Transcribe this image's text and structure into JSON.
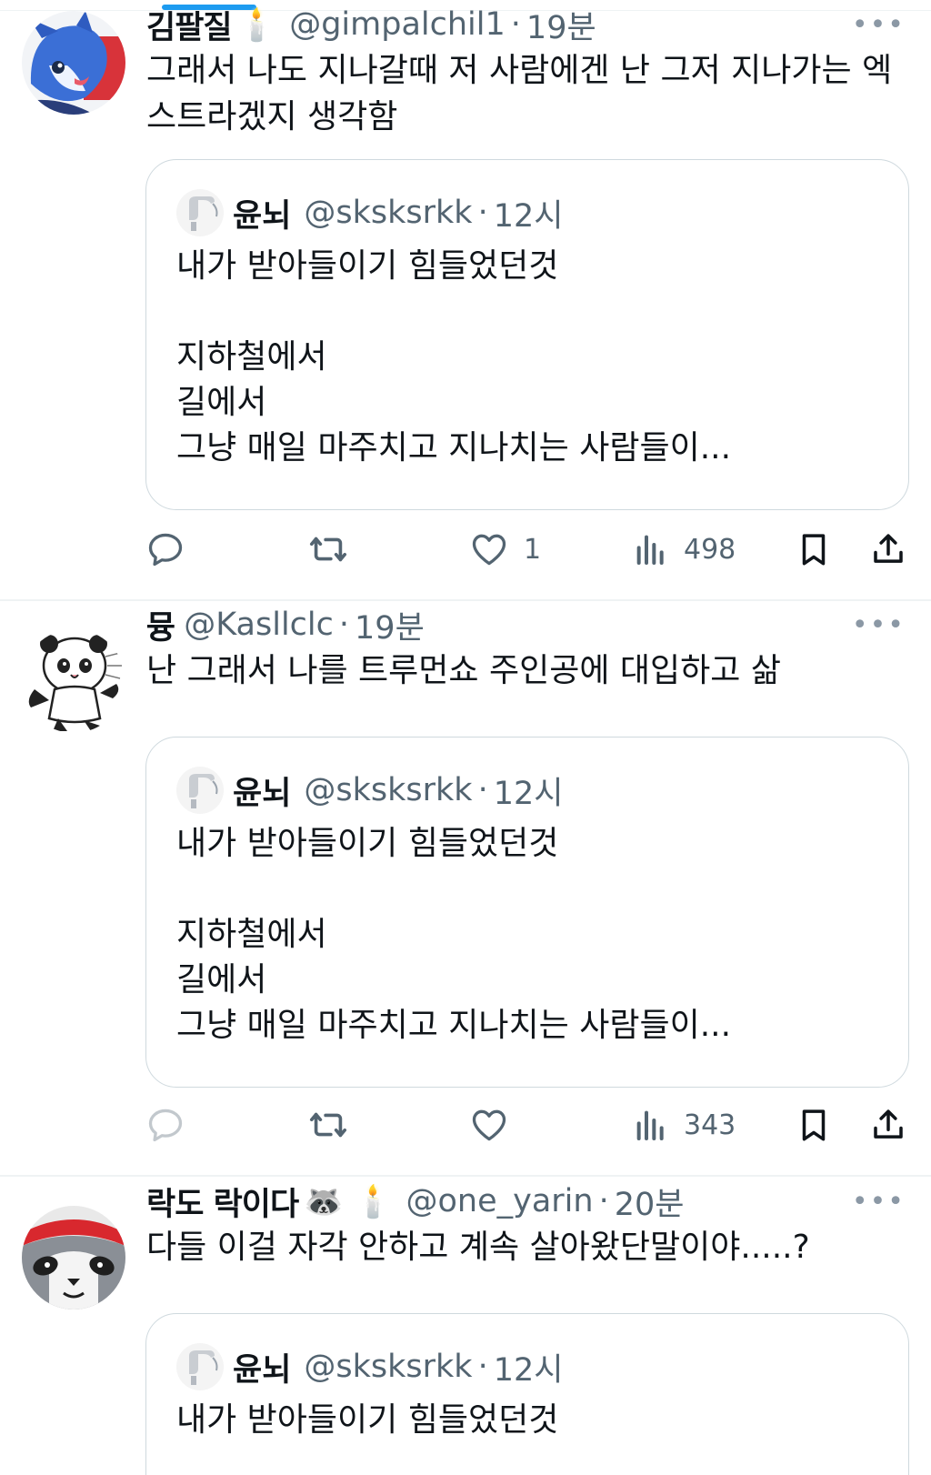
{
  "tweets": [
    {
      "author_name": "김팔질",
      "name_emoji": "🕯️",
      "handle": "@gimpalchil1",
      "separator": "·",
      "time": "19분",
      "text": "그래서 나도 지나갈때 저 사람에겐 난 그저 지나가는 엑\n스트라겠지 생각함",
      "quote": {
        "name": "윤뇌",
        "handle": "@sksksrkk",
        "separator": "·",
        "time": "12시",
        "text": "내가 받아들이기 힘들었던것\n\n지하철에서\n길에서\n그냥 매일 마주치고 지나치는 사람들이..."
      },
      "like_count": "1",
      "view_count": "498"
    },
    {
      "author_name": "뮹",
      "handle": "@Kasllclc",
      "separator": "·",
      "time": "19분",
      "text": "난 그래서 나를 트루먼쇼 주인공에 대입하고 삶",
      "quote": {
        "name": "윤뇌",
        "handle": "@sksksrkk",
        "separator": "·",
        "time": "12시",
        "text": "내가 받아들이기 힘들었던것\n\n지하철에서\n길에서\n그냥 매일 마주치고 지나치는 사람들이..."
      },
      "like_count": "",
      "view_count": "343"
    },
    {
      "author_name": "락도 락이다",
      "name_emoji": "🦝 🕯️",
      "handle": "@one_yarin",
      "separator": "·",
      "time": "20분",
      "text": "다들 이걸 자각 안하고 계속 살아왔단말이야.....?",
      "quote": {
        "name": "윤뇌",
        "handle": "@sksksrkk",
        "separator": "·",
        "time": "12시",
        "text": "내가 받아들이기 힘들었던것"
      }
    }
  ],
  "icons": {
    "more": "more-icon",
    "reply": "reply-icon",
    "retweet": "retweet-icon",
    "like": "heart-icon",
    "views": "views-icon",
    "bookmark": "bookmark-icon",
    "share": "share-icon"
  },
  "more_glyph": "•••",
  "colors": {
    "text": "#0f1419",
    "secondary": "#536471",
    "border": "#cfd9de",
    "divider": "#eff3f4",
    "accent": "#1d9bf0"
  }
}
